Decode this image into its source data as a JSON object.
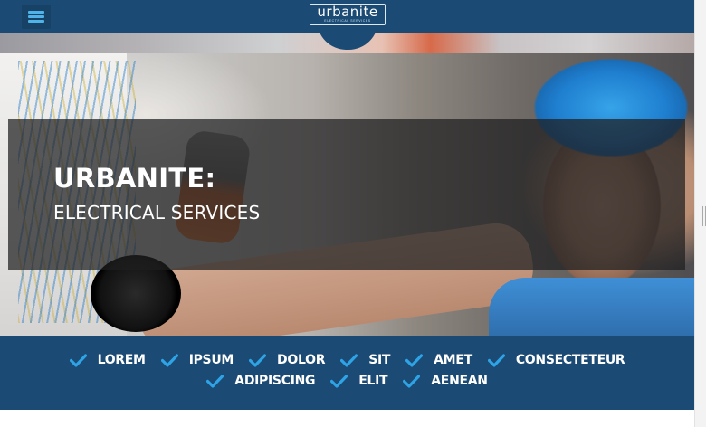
{
  "header": {
    "menu_icon": "hamburger-menu-icon",
    "logo_text": "urbanite",
    "logo_subtext": "ELECTRICAL SERVICES",
    "background_color": "#1b4a74",
    "accent_color": "#4fb3ea"
  },
  "hero": {
    "title": "URBANITE:",
    "subtitle": "ELECTRICAL SERVICES"
  },
  "features": {
    "icon": "checkmark-icon",
    "check_color": "#2ea3e6",
    "row1": [
      "LOREM",
      "IPSUM",
      "DOLOR",
      "SIT",
      "AMET",
      "CONSECTETEUR"
    ],
    "row2": [
      "ADIPISCING",
      "ELIT",
      "AENEAN"
    ]
  }
}
